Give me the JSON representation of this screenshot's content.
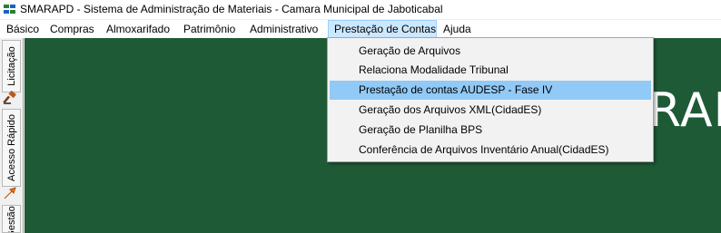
{
  "window": {
    "title": "SMARAPD - Sistema de Administração de Materiais - Camara Municipal de Jaboticabal"
  },
  "menubar": [
    {
      "label": "Básico"
    },
    {
      "label": "Compras"
    },
    {
      "label": "Almoxarifado"
    },
    {
      "label": "Patrimônio"
    },
    {
      "label": "Administrativo"
    },
    {
      "label": "Prestação de Contas",
      "active": true
    },
    {
      "label": "Ajuda"
    }
  ],
  "dropdown": {
    "items": [
      {
        "label": "Geração de Arquivos"
      },
      {
        "label": "Relaciona Modalidade Tribunal"
      },
      {
        "label": "Prestação de contas AUDESP - Fase IV",
        "highlighted": true
      },
      {
        "label": "Geração dos Arquivos XML(CidadES)"
      },
      {
        "label": "Geração de Planilha BPS"
      },
      {
        "label": "Conferência de Arquivos Inventário Anual(CidadES)"
      }
    ]
  },
  "sidebar": {
    "tabs": [
      {
        "label": "Licitação",
        "icon": "gavel-icon"
      },
      {
        "label": "Acesso Rápido",
        "icon": "arrow-icon"
      },
      {
        "label": "Gestão"
      }
    ]
  },
  "main": {
    "logo_text": "RAI"
  },
  "colors": {
    "main_bg": "#1f5a36",
    "menu_active": "#cce8ff",
    "dropdown_highlight": "#91c9f7"
  }
}
